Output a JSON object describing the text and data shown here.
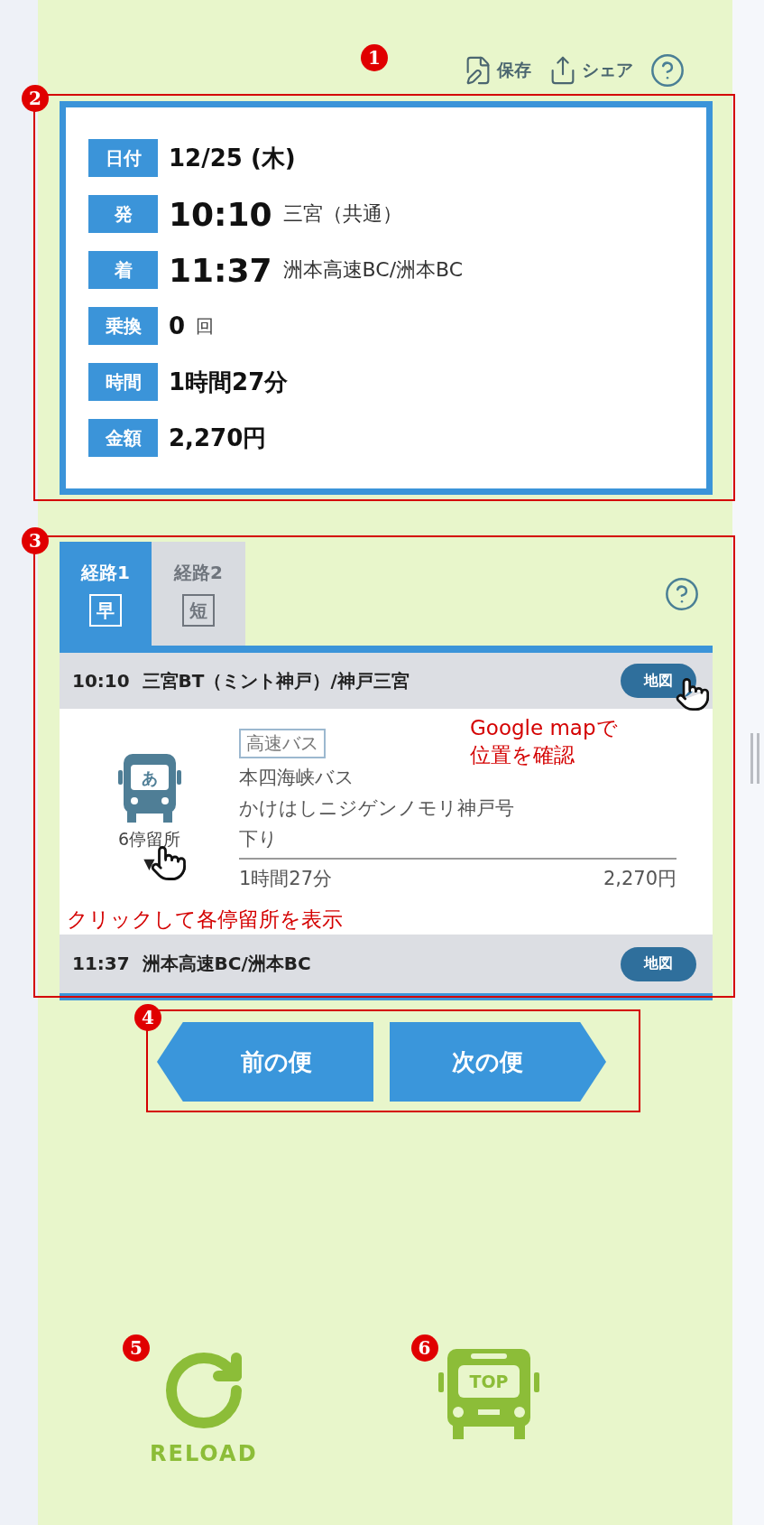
{
  "toolbar": {
    "marker": "1",
    "save": "保存",
    "share": "シェア"
  },
  "summary": {
    "marker": "2",
    "rows": [
      {
        "kind": "plain",
        "label": "日付",
        "value": "12/25 (木)"
      },
      {
        "kind": "time",
        "label": "発",
        "time": "10:10",
        "place": "三宮（共通）"
      },
      {
        "kind": "time",
        "label": "着",
        "time": "11:37",
        "place": "洲本高速BC/洲本BC"
      },
      {
        "kind": "count",
        "label": "乗換",
        "value": "0",
        "unit": "回"
      },
      {
        "kind": "plain",
        "label": "時間",
        "value": "1時間27分"
      },
      {
        "kind": "plain",
        "label": "金額",
        "value": "2,270円"
      }
    ]
  },
  "route": {
    "marker": "3",
    "tabs": [
      {
        "label": "経路1",
        "badge": "早",
        "selected": true
      },
      {
        "label": "経路2",
        "badge": "短",
        "selected": false
      }
    ],
    "departure": {
      "time": "10:10",
      "stop": "三宮BT（ミント神戸）/神戸三宮",
      "map": "地図"
    },
    "leg": {
      "bus_label": "あ",
      "stops": "6停留所",
      "expander": "▼",
      "type": "高速バス",
      "operator": "本四海峡バス",
      "line": "かけはしニジゲンノモリ神戸号",
      "direction": "下り",
      "duration": "1時間27分",
      "fare": "2,270円"
    },
    "arrival": {
      "time": "11:37",
      "stop": "洲本高速BC/洲本BC",
      "map": "地図"
    },
    "map_note": [
      "Google mapで",
      "位置を確認"
    ],
    "stops_note": "クリックして各停留所を表示"
  },
  "nav": {
    "marker": "4",
    "buttons": [
      {
        "kind": "prev",
        "label": "前の便"
      },
      {
        "kind": "next",
        "label": "次の便"
      }
    ]
  },
  "footer": {
    "reload": {
      "marker": "5",
      "label": "RELOAD"
    },
    "top": {
      "marker": "6",
      "label": "TOP"
    }
  }
}
